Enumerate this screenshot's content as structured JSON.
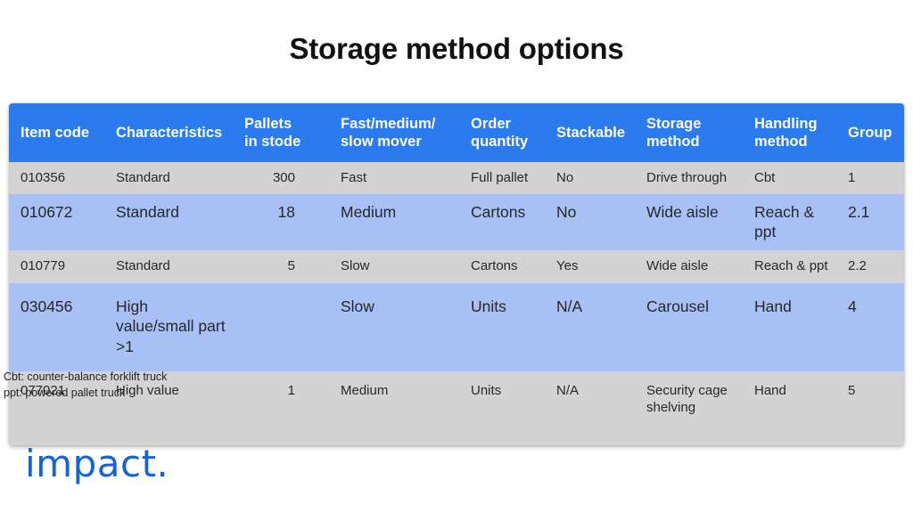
{
  "slide": {
    "title": "Storage method options",
    "background_color": "#ffffff"
  },
  "colors": {
    "header_blue": "#2b7aee",
    "row_blue": "#a9c0f4",
    "row_gray": "#d3d3d3",
    "text_dark": "#25282b",
    "logo_blue": "#1463d8"
  },
  "table": {
    "headers": [
      "Item code",
      "Characteristics",
      "Pallets\nin stode",
      "Fast/medium/\nslow mover",
      "Order\nquantity",
      "Stackable",
      "Storage\nmethod",
      "Handling\nmethod",
      "Group"
    ],
    "header_lines": {
      "h0a": "Item code",
      "h0b": "",
      "h1a": "Characteristics",
      "h1b": "",
      "h2a": "Pallets",
      "h2b": "in stode",
      "h3a": "Fast/medium/",
      "h3b": "slow mover",
      "h4a": "Order",
      "h4b": "quantity",
      "h5a": "Stackable",
      "h5b": "",
      "h6a": "Storage",
      "h6b": "method",
      "h7a": "Handling",
      "h7b": "method",
      "h8a": "Group",
      "h8b": ""
    },
    "rows": [
      {
        "item_code": "010356",
        "characteristics": "Standard",
        "pallets_in_stode": "300",
        "mover": "Fast",
        "order_quantity": "Full pallet",
        "stackable": "No",
        "storage_method": "Drive through",
        "handling_method": "Cbt",
        "group": "1"
      },
      {
        "item_code": "010672",
        "characteristics": "Standard",
        "pallets_in_stode": "18",
        "mover": "Medium",
        "order_quantity": "Cartons",
        "stackable": "No",
        "storage_method": "Wide aisle",
        "handling_method": "Reach & ppt",
        "group": "2.1"
      },
      {
        "item_code": "010779",
        "characteristics": "Standard",
        "pallets_in_stode": "5",
        "mover": "Slow",
        "order_quantity": "Cartons",
        "stackable": "Yes",
        "storage_method": "Wide aisle",
        "handling_method": "Reach & ppt",
        "group": "2.2"
      },
      {
        "item_code": "030456",
        "characteristics": "High value/small part >1",
        "pallets_in_stode": "",
        "mover": "Slow",
        "order_quantity": "Units",
        "stackable": "N/A",
        "storage_method": "Carousel",
        "handling_method": "Hand",
        "group": "4"
      },
      {
        "item_code": "077021",
        "characteristics": "High value",
        "pallets_in_stode": "1",
        "mover": "Medium",
        "order_quantity": "Units",
        "stackable": "N/A",
        "storage_method": "Security cage shelving",
        "handling_method": "Hand",
        "group": "5"
      }
    ]
  },
  "footnotes": {
    "line1": "Cbt: counter-balance forklift truck",
    "line2": "ppt: powered pallet truck"
  },
  "logo": {
    "text": "impact."
  }
}
